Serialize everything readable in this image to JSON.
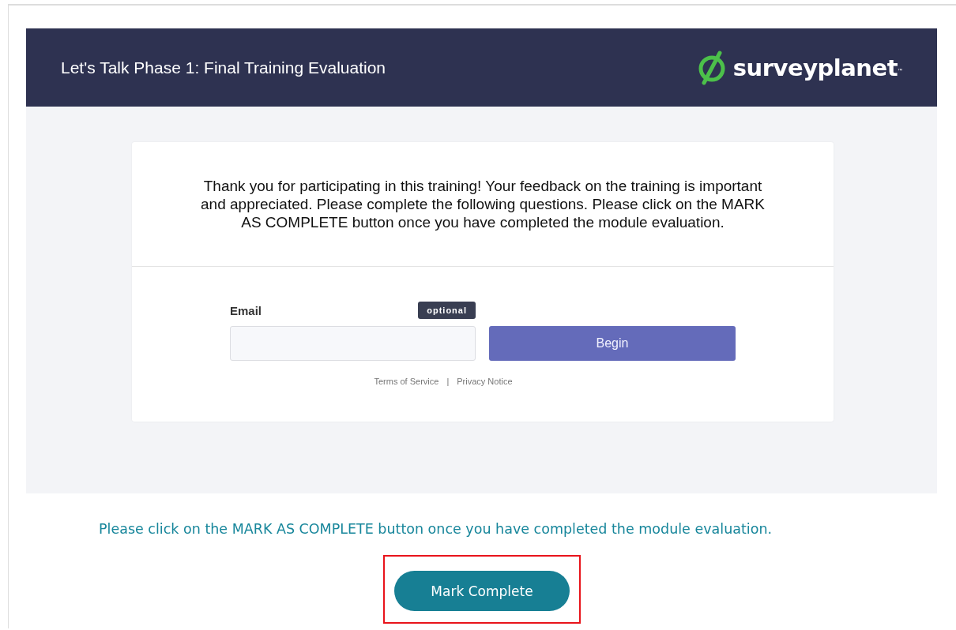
{
  "header": {
    "title": "Let's Talk Phase 1: Final Training Evaluation",
    "logo": {
      "name": "surveyplanet",
      "mark": "™"
    }
  },
  "intro": "Thank you for participating in this training! Your feedback on the training is important and appreciated. Please complete the following questions. Please click on the MARK AS COMPLETE button once you have completed the module evaluation.",
  "form": {
    "email_label": "Email",
    "badge": "optional",
    "begin_button": "Begin",
    "links": [
      "Terms of Service",
      "Privacy Notice"
    ],
    "separator": "|"
  },
  "instruction": "Please click on the MARK AS COMPLETE button once you have completed the module evaluation.",
  "complete_button": "Mark Complete"
}
